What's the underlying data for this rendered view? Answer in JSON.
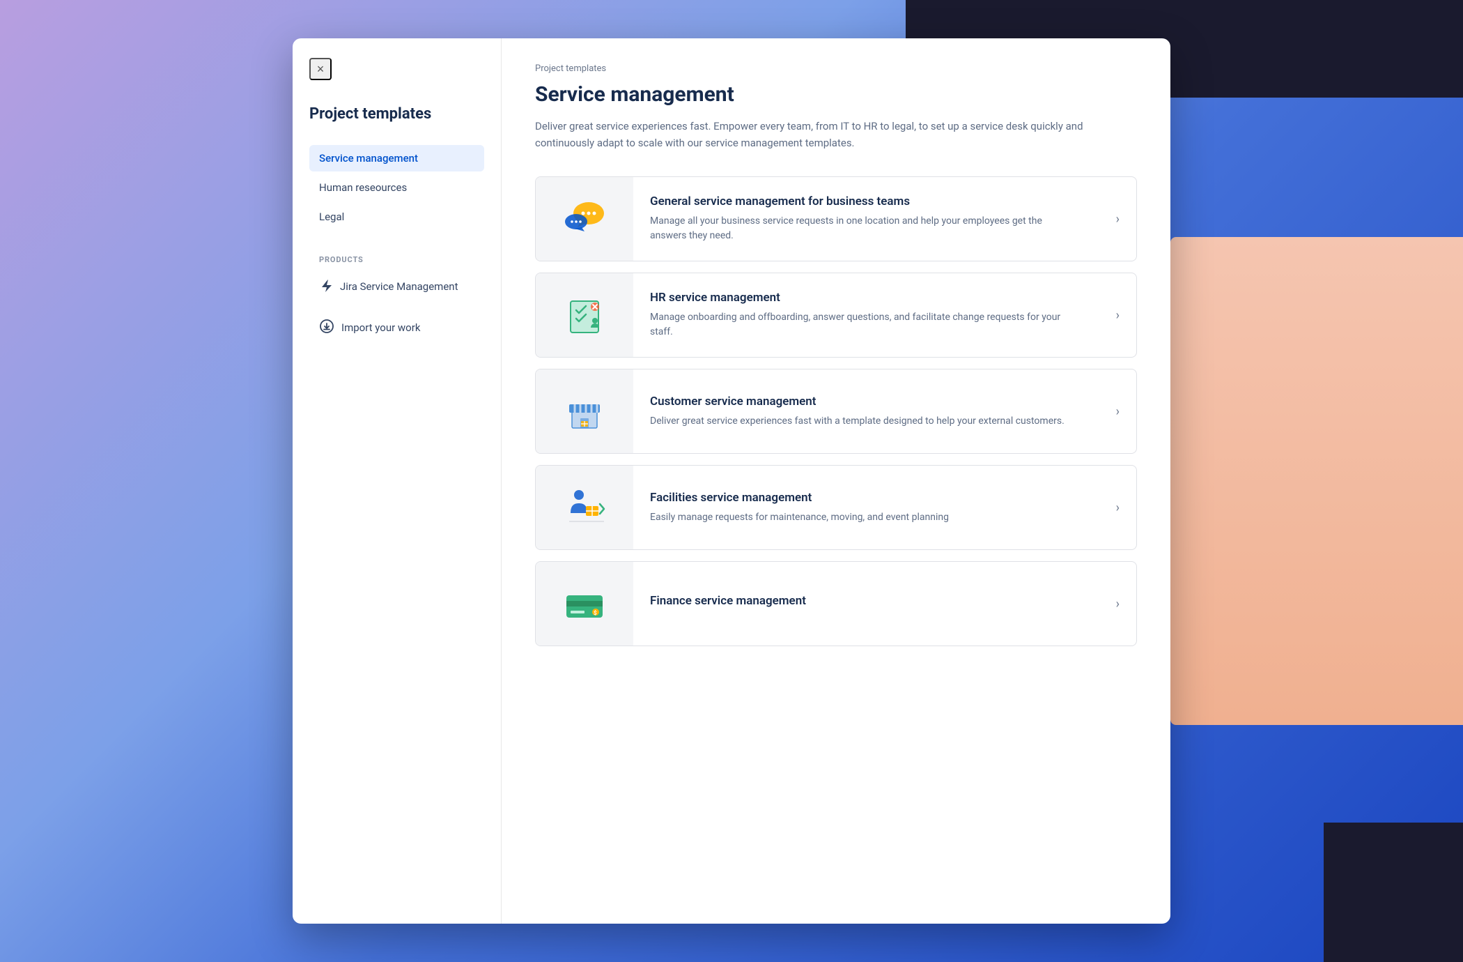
{
  "background": {
    "colors": {
      "primary": "#7b8fd4",
      "dark": "#1a1a2e",
      "salmon": "#f0b090"
    }
  },
  "modal": {
    "close_label": "×",
    "sidebar": {
      "title": "Project templates",
      "nav_items": [
        {
          "id": "service-management",
          "label": "Service management",
          "active": true
        },
        {
          "id": "human-resources",
          "label": "Human reseources",
          "active": false
        },
        {
          "id": "legal",
          "label": "Legal",
          "active": false
        }
      ],
      "products_section_label": "PRODUCTS",
      "products": [
        {
          "id": "jira-service-management",
          "label": "Jira Service Management"
        }
      ],
      "import_label": "Import your work"
    },
    "main": {
      "breadcrumb": "Project templates",
      "title": "Service management",
      "description": "Deliver great service experiences fast. Empower every team, from IT to HR to legal, to set up a service desk quickly and continuously adapt to scale with our service management templates.",
      "templates": [
        {
          "id": "general-service",
          "title": "General service management for business teams",
          "description": "Manage all your business service requests in one location and help your employees get the answers they need.",
          "icon_type": "general"
        },
        {
          "id": "hr-service",
          "title": "HR service management",
          "description": "Manage onboarding and offboarding, answer questions, and facilitate change requests for your staff.",
          "icon_type": "hr"
        },
        {
          "id": "customer-service",
          "title": "Customer service management",
          "description": "Deliver great service experiences fast with a template designed to help your external customers.",
          "icon_type": "customer"
        },
        {
          "id": "facilities-service",
          "title": "Facilities service management",
          "description": "Easily manage requests for maintenance, moving, and event planning",
          "icon_type": "facilities"
        },
        {
          "id": "finance-service",
          "title": "Finance service management",
          "description": "",
          "icon_type": "finance"
        }
      ]
    }
  }
}
